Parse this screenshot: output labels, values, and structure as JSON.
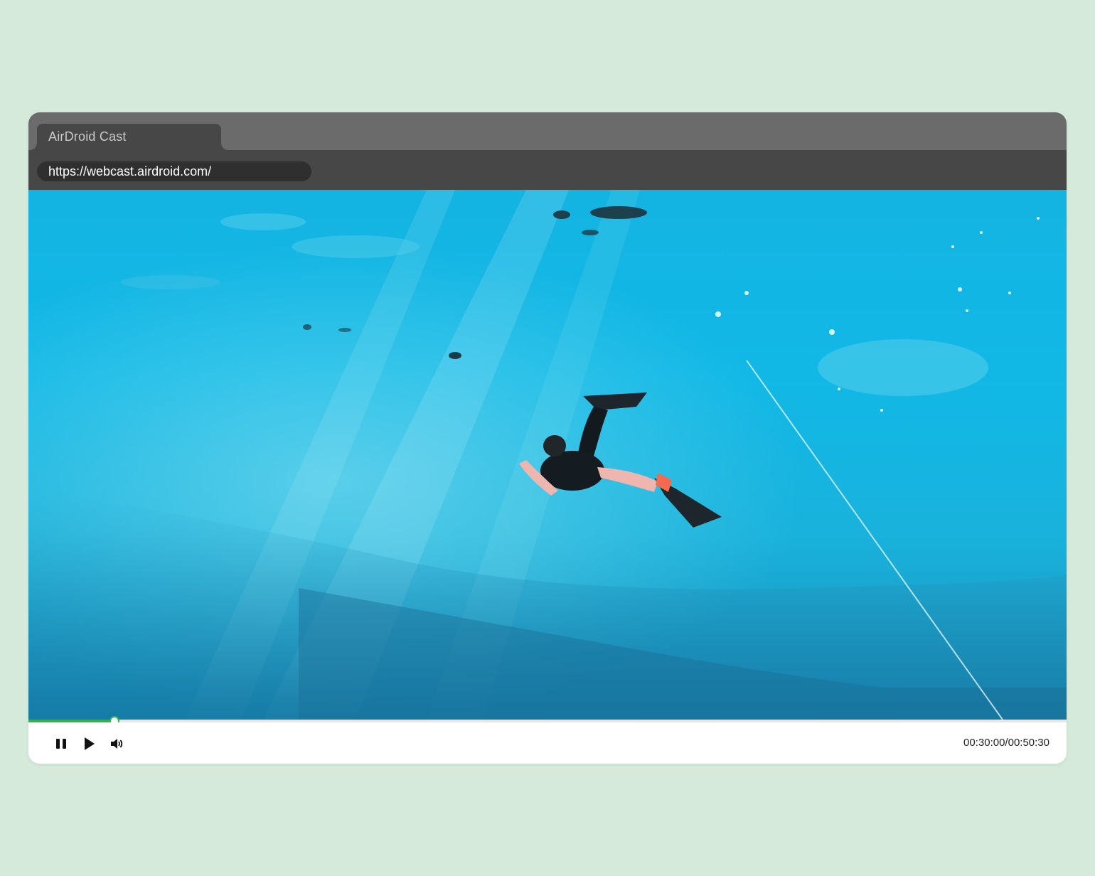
{
  "browser": {
    "tab_title": "AirDroid Cast",
    "url": "https://webcast.airdroid.com/"
  },
  "player": {
    "current_time": "00:30:00",
    "duration": "00:50:30",
    "time_display": "00:30:00/00:50:30",
    "progress_fraction": 0.083,
    "icons": [
      "pause-icon",
      "play-icon",
      "volume-icon"
    ]
  },
  "colors": {
    "page_background": "#d5eadb",
    "tab_bar": "#6b6b6b",
    "active_tab": "#474747",
    "address_bar": "#474747",
    "url_field": "#2f2f2f",
    "progress_accent": "#33b34f",
    "water": "#17b6e0"
  }
}
